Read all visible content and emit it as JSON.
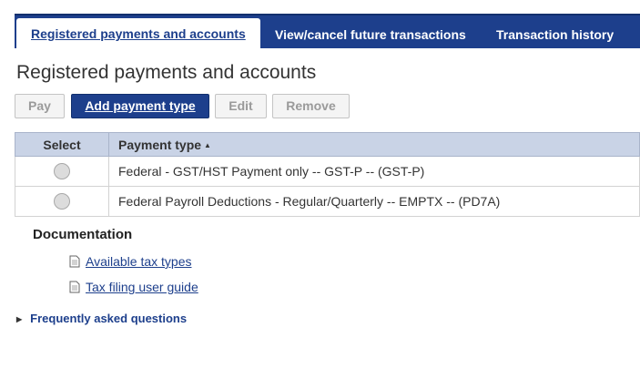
{
  "tabs": [
    {
      "label": "Registered payments and accounts",
      "active": true
    },
    {
      "label": "View/cancel future transactions",
      "active": false
    },
    {
      "label": "Transaction history",
      "active": false
    }
  ],
  "page_title": "Registered payments and accounts",
  "toolbar": {
    "pay_label": "Pay",
    "add_label": "Add payment type",
    "edit_label": "Edit",
    "remove_label": "Remove"
  },
  "table": {
    "headers": {
      "select": "Select",
      "payment_type": "Payment type"
    },
    "sort_icon": "sort-ascending-icon",
    "rows": [
      {
        "payment_type": "Federal - GST/HST Payment only -- GST-P -- (GST-P)"
      },
      {
        "payment_type": "Federal Payroll Deductions - Regular/Quarterly -- EMPTX -- (PD7A)"
      }
    ]
  },
  "documentation": {
    "heading": "Documentation",
    "links": [
      {
        "label": "Available tax types",
        "icon": "document-icon"
      },
      {
        "label": "Tax filing user guide",
        "icon": "document-icon"
      }
    ]
  },
  "faq": {
    "label": "Frequently asked questions",
    "icon": "caret-right-icon"
  },
  "colors": {
    "brand": "#1d3f8c",
    "header_bg": "#c9d3e6"
  }
}
